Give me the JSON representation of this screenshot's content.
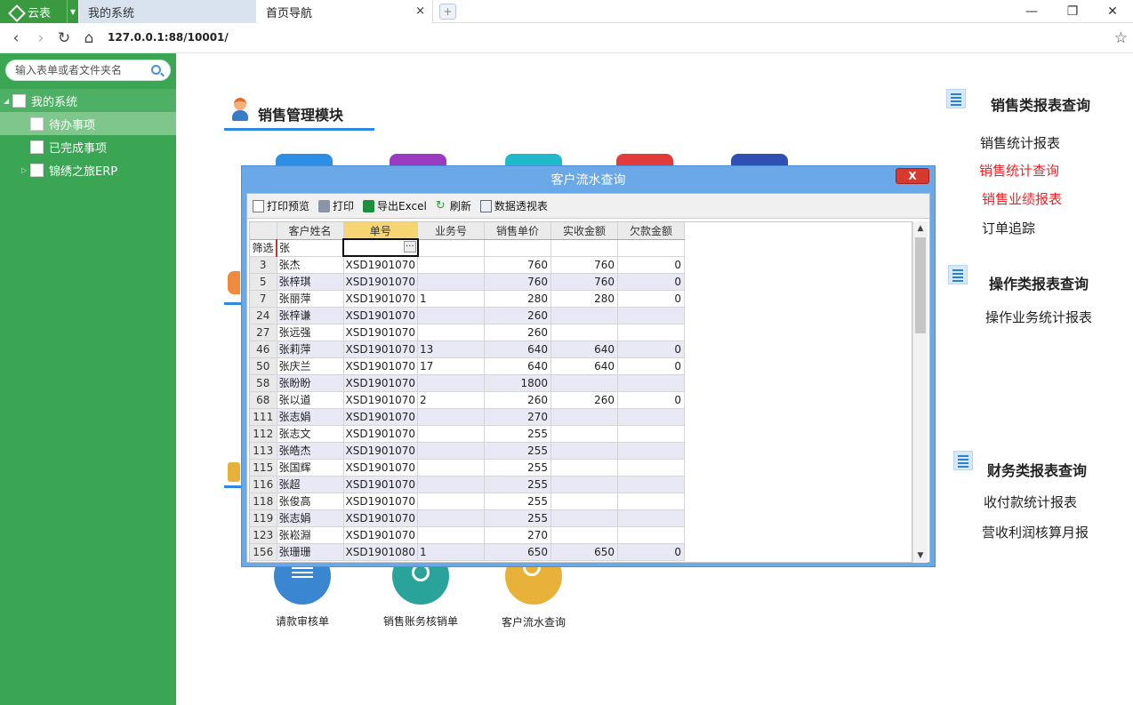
{
  "app": {
    "name": "云表"
  },
  "tabs": {
    "system": "我的系统",
    "home": "首页导航",
    "close": "×",
    "add": "+"
  },
  "window": {
    "minimize": "—",
    "restore": "❐",
    "close": "✕"
  },
  "address": {
    "url": "127.0.0.1:88/10001/"
  },
  "sidebar": {
    "search_placeholder": "输入表单或者文件夹名",
    "items": [
      {
        "label": "我的系统"
      },
      {
        "label": "待办事项"
      },
      {
        "label": "已完成事项"
      },
      {
        "label": "锦绣之旅ERP"
      }
    ]
  },
  "main": {
    "module_title": "销售管理模块",
    "bottom_icons": [
      {
        "label": "请款审核单",
        "color": "#3a86d0"
      },
      {
        "label": "销售账务核销单",
        "color": "#2aa39b"
      },
      {
        "label": "客户流水查询",
        "color": "#e8b23a"
      }
    ],
    "top_tile_colors": [
      "#2d8ee6",
      "#9b3bc2",
      "#1fb9c9",
      "#e23b3b",
      "#2f4fb4"
    ]
  },
  "reports": [
    {
      "heading": "销售类报表查询",
      "links": [
        {
          "label": "销售统计报表",
          "red": false
        },
        {
          "label": "销售统计查询",
          "red": true
        },
        {
          "label": "销售业绩报表",
          "red": true
        },
        {
          "label": "订单追踪",
          "red": false
        }
      ]
    },
    {
      "heading": "操作类报表查询",
      "links": [
        {
          "label": "操作业务统计报表",
          "red": false
        }
      ]
    },
    {
      "heading": "财务类报表查询",
      "links": [
        {
          "label": "收付款统计报表",
          "red": false
        },
        {
          "label": "营收利润核算月报",
          "red": false
        }
      ]
    }
  ],
  "dialog": {
    "title": "客户流水查询",
    "close_label": "X",
    "toolbar": {
      "print_preview": "打印预览",
      "print": "打印",
      "export_excel": "导出Excel",
      "refresh": "刷新",
      "pivot": "数据透视表"
    },
    "grid": {
      "columns": [
        "客户姓名",
        "单号",
        "业务号",
        "销售单价",
        "实收金额",
        "欠款金额"
      ],
      "filter_label": "筛选",
      "filter_value": "张",
      "ellipsis": "···",
      "rows": [
        {
          "n": "3",
          "name": "张杰",
          "no": "XSD1901070",
          "biz": "",
          "price": "760",
          "paid": "760",
          "owe": "0"
        },
        {
          "n": "5",
          "name": "张梓琪",
          "no": "XSD1901070",
          "biz": "",
          "price": "760",
          "paid": "760",
          "owe": "0"
        },
        {
          "n": "7",
          "name": "张丽萍",
          "no": "XSD1901070",
          "biz": "1",
          "price": "280",
          "paid": "280",
          "owe": "0"
        },
        {
          "n": "24",
          "name": "张梓谦",
          "no": "XSD1901070",
          "biz": "",
          "price": "260",
          "paid": "",
          "owe": ""
        },
        {
          "n": "27",
          "name": "张远强",
          "no": "XSD1901070",
          "biz": "",
          "price": "260",
          "paid": "",
          "owe": ""
        },
        {
          "n": "46",
          "name": "张莉萍",
          "no": "XSD1901070",
          "biz": "13",
          "price": "640",
          "paid": "640",
          "owe": "0"
        },
        {
          "n": "50",
          "name": "张庆兰",
          "no": "XSD1901070",
          "biz": "17",
          "price": "640",
          "paid": "640",
          "owe": "0"
        },
        {
          "n": "58",
          "name": "张盼盼",
          "no": "XSD1901070",
          "biz": "",
          "price": "1800",
          "paid": "",
          "owe": ""
        },
        {
          "n": "68",
          "name": "张以道",
          "no": "XSD1901070",
          "biz": "2",
          "price": "260",
          "paid": "260",
          "owe": "0"
        },
        {
          "n": "111",
          "name": "张志娟",
          "no": "XSD1901070",
          "biz": "",
          "price": "270",
          "paid": "",
          "owe": ""
        },
        {
          "n": "112",
          "name": "张志文",
          "no": "XSD1901070",
          "biz": "",
          "price": "255",
          "paid": "",
          "owe": ""
        },
        {
          "n": "113",
          "name": "张皓杰",
          "no": "XSD1901070",
          "biz": "",
          "price": "255",
          "paid": "",
          "owe": ""
        },
        {
          "n": "115",
          "name": "张国辉",
          "no": "XSD1901070",
          "biz": "",
          "price": "255",
          "paid": "",
          "owe": ""
        },
        {
          "n": "116",
          "name": "张超",
          "no": "XSD1901070",
          "biz": "",
          "price": "255",
          "paid": "",
          "owe": ""
        },
        {
          "n": "118",
          "name": "张俊高",
          "no": "XSD1901070",
          "biz": "",
          "price": "255",
          "paid": "",
          "owe": ""
        },
        {
          "n": "119",
          "name": "张志娟",
          "no": "XSD1901070",
          "biz": "",
          "price": "255",
          "paid": "",
          "owe": ""
        },
        {
          "n": "123",
          "name": "张崧淵",
          "no": "XSD1901070",
          "biz": "",
          "price": "270",
          "paid": "",
          "owe": ""
        },
        {
          "n": "156",
          "name": "张珊珊",
          "no": "XSD1901080",
          "biz": "1",
          "price": "650",
          "paid": "650",
          "owe": "0"
        }
      ]
    }
  }
}
